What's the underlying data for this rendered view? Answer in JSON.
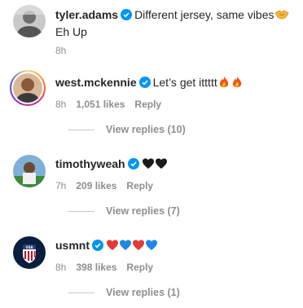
{
  "comments": [
    {
      "username": "tyler.adams",
      "text": "Different jersey, same vibes",
      "emoji_end": "handshake",
      "continuation": "Eh Up",
      "time": "8h",
      "likes": "",
      "reply_label": ""
    },
    {
      "username": "west.mckennie",
      "text": "Let’s get ittttt",
      "emoji_end": "fire fire",
      "time": "8h",
      "likes": "1,051 likes",
      "reply_label": "Reply",
      "view_replies": "View replies (10)"
    },
    {
      "username": "timothyweah",
      "text": "",
      "emoji_end": "black-heart black-heart",
      "time": "7h",
      "likes": "209 likes",
      "reply_label": "Reply",
      "view_replies": "View replies (7)"
    },
    {
      "username": "usmnt",
      "text": "",
      "emoji_end": "red-heart blue-heart red-heart blue-heart",
      "time": "8h",
      "likes": "398 likes",
      "reply_label": "Reply",
      "view_replies": "View replies (1)"
    }
  ],
  "colors": {
    "verified": "#0095f6",
    "meta_gray": "#8e8e8e",
    "text": "#262626"
  }
}
